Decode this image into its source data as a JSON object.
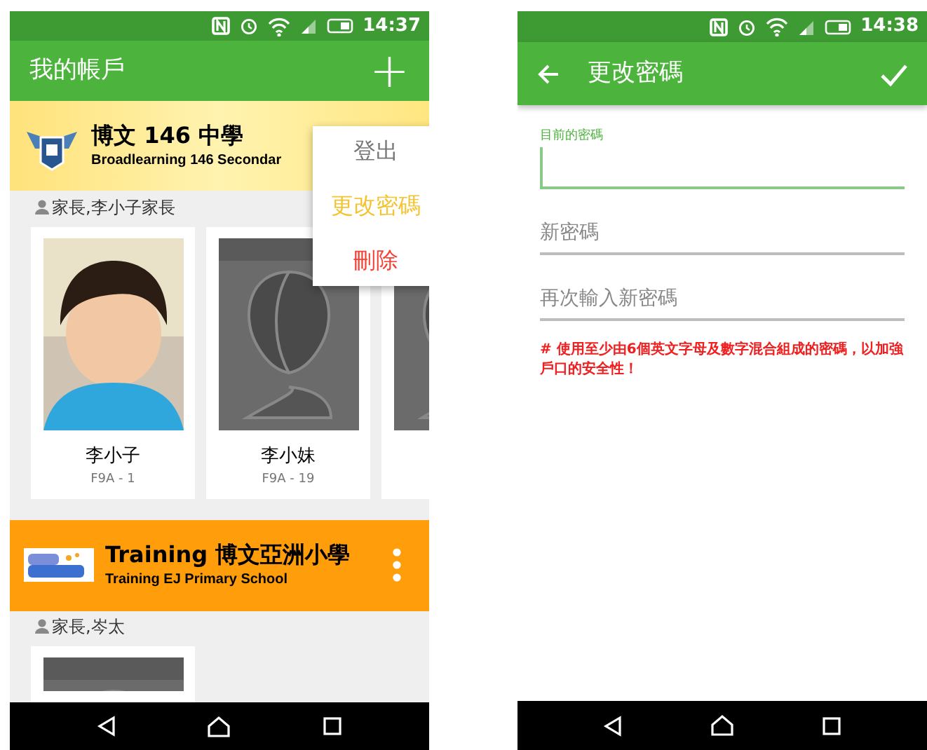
{
  "screens": [
    {
      "status_bar": {
        "time": "14:37"
      },
      "app_bar": {
        "title": "我的帳戶",
        "action": "+"
      },
      "schools": [
        {
          "kind": "banner",
          "name": "博文 146 中學",
          "subtitle": "Broadlearning 146 Secondar",
          "parent": "家長,李小子家長",
          "children": [
            {
              "name": "李小子",
              "class": "F9A - 1"
            },
            {
              "name": "李小妹",
              "class": "F9A - 19",
              "kind": "placeholder"
            },
            {
              "kind": "placeholder"
            }
          ]
        },
        {
          "kind": "orange",
          "name": "Training 博文亞洲小學",
          "subtitle": "Training EJ Primary School",
          "parent": "家長,岑太",
          "children": [
            {
              "kind": "placeholder"
            }
          ]
        }
      ],
      "menu": [
        {
          "label": "登出",
          "color": "#757575"
        },
        {
          "label": "更改密碼",
          "color": "#f4c430"
        },
        {
          "label": "刪除",
          "color": "#f44336"
        }
      ]
    },
    {
      "status_bar": {
        "time": "14:38"
      },
      "app_bar": {
        "title": "更改密碼"
      },
      "fields": [
        {
          "label": "目前的密碼",
          "focused": true
        },
        {
          "placeholder": "新密碼",
          "focused": false
        },
        {
          "placeholder": "再次輸入新密碼",
          "focused": false
        }
      ],
      "hint": "# 使用至少由6個英文字母及數字混合組成的密碼，以加強戶口的安全性！"
    }
  ]
}
